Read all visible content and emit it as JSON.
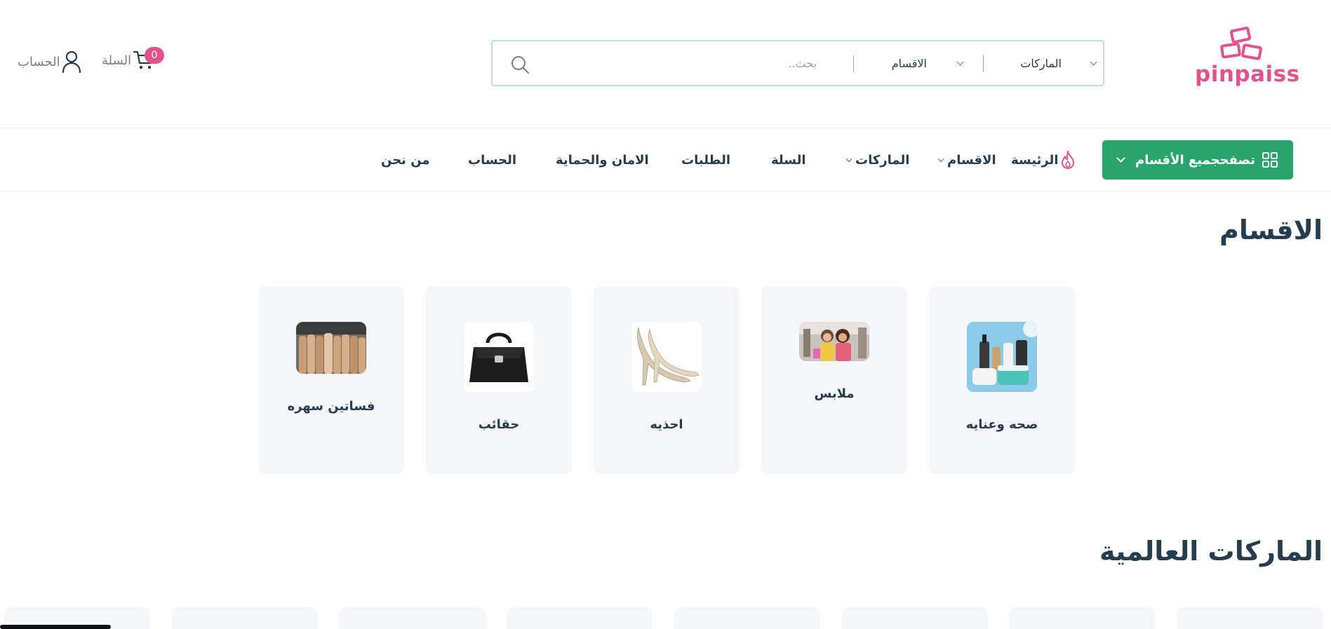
{
  "header": {
    "logo_text": "pinpaiss",
    "search": {
      "brands_label": "الماركات",
      "categories_label": "الاقسام",
      "placeholder": "بحث.."
    },
    "cart": {
      "label": "السلة",
      "count": "0"
    },
    "account": {
      "label": "الحساب"
    }
  },
  "nav": {
    "browse_button": "تصفحجميع الأقسام",
    "items": {
      "home": "الرئيسة",
      "categories": "الاقسام",
      "brands": "الماركات",
      "cart": "السلة",
      "orders": "الطلبات",
      "security": "الامان والحماية",
      "account": "الحساب",
      "about": "من نحن"
    }
  },
  "categories_section": {
    "title": "الاقسام",
    "cards": [
      {
        "label": "صحه وعنايه",
        "image": "cosmetics"
      },
      {
        "label": "ملابس",
        "image": "shopping-women"
      },
      {
        "label": "احذيه",
        "image": "glitter-heels"
      },
      {
        "label": "حقائب",
        "image": "black-handbag"
      },
      {
        "label": "فساتين سهره",
        "image": "bridesmaids-dresses"
      }
    ]
  },
  "brands_section": {
    "title": "الماركات العالمية"
  },
  "colors": {
    "accent_green": "#29a56c",
    "brand_pink": "#e2528d",
    "text_dark": "#253d4e",
    "card_bg": "#f4f6fa"
  }
}
